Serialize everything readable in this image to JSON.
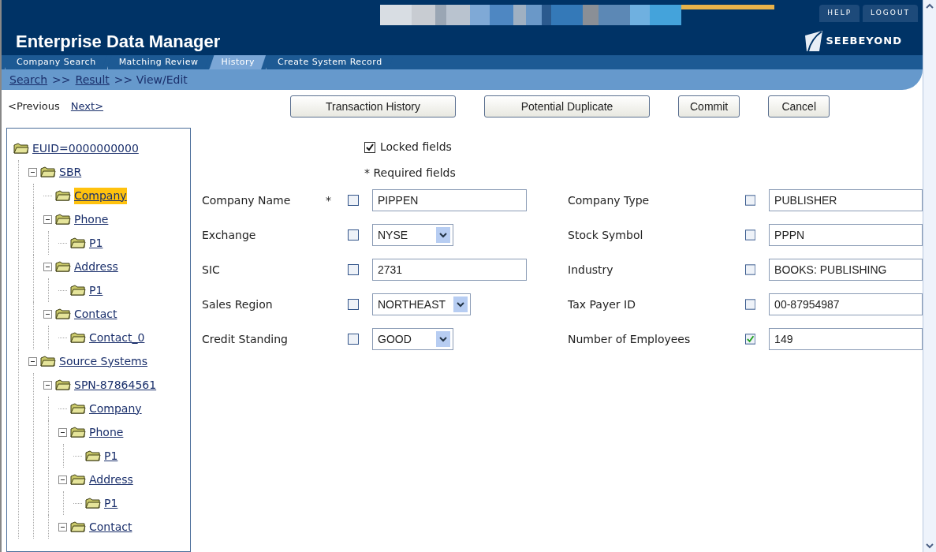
{
  "header": {
    "title": "Enterprise Data Manager",
    "top_links": [
      "HELP",
      "LOGOUT"
    ],
    "logo_text": "SEEBEYOND"
  },
  "tabs": [
    {
      "label": "Company Search",
      "selected": false
    },
    {
      "label": "Matching Review",
      "selected": false
    },
    {
      "label": "History",
      "selected": true
    },
    {
      "label": "Create System Record",
      "selected": false
    }
  ],
  "breadcrumb": [
    {
      "kind": "link",
      "text": "Search"
    },
    {
      "kind": "text",
      "text": ">>"
    },
    {
      "kind": "link",
      "text": "Result"
    },
    {
      "kind": "text",
      "text": ">> View/Edit"
    }
  ],
  "pager": {
    "previous": {
      "label": "<Previous",
      "disabled": true
    },
    "next": {
      "label": "Next>",
      "disabled": false
    }
  },
  "actions": [
    "Transaction History",
    "Potential Duplicate",
    "Commit",
    "Cancel"
  ],
  "tree": [
    {
      "label": "EUID=0000000000",
      "selected": false,
      "children": [
        {
          "label": "SBR",
          "selected": false,
          "expanded": true,
          "children": [
            {
              "label": "Company",
              "selected": true
            },
            {
              "label": "Phone",
              "selected": false,
              "expanded": true,
              "children": [
                {
                  "label": "P1",
                  "selected": false
                }
              ]
            },
            {
              "label": "Address",
              "selected": false,
              "expanded": true,
              "children": [
                {
                  "label": "P1",
                  "selected": false
                }
              ]
            },
            {
              "label": "Contact",
              "selected": false,
              "expanded": true,
              "children": [
                {
                  "label": "Contact_0",
                  "selected": false
                }
              ]
            }
          ]
        },
        {
          "label": "Source Systems",
          "selected": false,
          "expanded": true,
          "children": [
            {
              "label": "SPN-87864561",
              "selected": false,
              "expanded": true,
              "children": [
                {
                  "label": "Company",
                  "selected": false
                },
                {
                  "label": "Phone",
                  "selected": false,
                  "expanded": true,
                  "children": [
                    {
                      "label": "P1",
                      "selected": false
                    }
                  ]
                },
                {
                  "label": "Address",
                  "selected": false,
                  "expanded": true,
                  "children": [
                    {
                      "label": "P1",
                      "selected": false
                    }
                  ]
                },
                {
                  "label": "Contact",
                  "selected": false,
                  "expanded": true
                }
              ]
            }
          ]
        }
      ]
    }
  ],
  "legend": {
    "locked": {
      "label": "Locked fields",
      "checked": true
    },
    "required": "* Required fields"
  },
  "fields_left": [
    {
      "label": "Company Name",
      "required_mark": "*",
      "locked": false,
      "kind": "text",
      "value": "PIPPEN"
    },
    {
      "label": "Exchange",
      "locked": false,
      "kind": "select",
      "value": "NYSE"
    },
    {
      "label": "SIC",
      "locked": false,
      "kind": "text",
      "value": "2731"
    },
    {
      "label": "Sales Region",
      "locked": false,
      "kind": "select",
      "value": "NORTHEAST"
    },
    {
      "label": "Credit Standing",
      "locked": false,
      "kind": "select",
      "value": "GOOD"
    }
  ],
  "fields_right": [
    {
      "label": "Company Type",
      "locked": false,
      "kind": "text",
      "value": "PUBLISHER"
    },
    {
      "label": "Stock Symbol",
      "locked": false,
      "kind": "text",
      "value": "PPPN"
    },
    {
      "label": "Industry",
      "locked": false,
      "kind": "text",
      "value": "BOOKS: PUBLISHING"
    },
    {
      "label": "Tax Payer ID",
      "locked": false,
      "kind": "text",
      "value": "00-87954987"
    },
    {
      "label": "Number of Employees",
      "locked": true,
      "kind": "text",
      "value": "149"
    }
  ]
}
